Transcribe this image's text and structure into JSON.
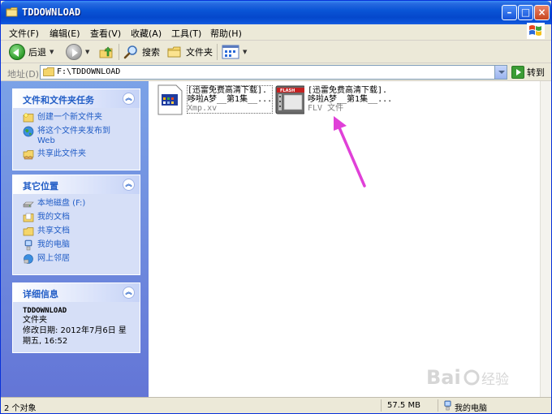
{
  "window": {
    "title": "TDDOWNLOAD"
  },
  "menu": [
    "文件(F)",
    "编辑(E)",
    "查看(V)",
    "收藏(A)",
    "工具(T)",
    "帮助(H)"
  ],
  "toolbar": {
    "back": "后退",
    "search": "搜索",
    "folders": "文件夹"
  },
  "address": {
    "label": "地址(D)",
    "value": "F:\\TDDOWNLOAD",
    "go": "转到"
  },
  "panels": {
    "tasks": {
      "title": "文件和文件夹任务",
      "items": [
        {
          "label": "创建一个新文件夹",
          "icon": "new-folder-icon"
        },
        {
          "label": "将这个文件夹发布到",
          "label2": "Web",
          "icon": "globe-icon"
        },
        {
          "label": "共享此文件夹",
          "icon": "share-folder-icon"
        }
      ]
    },
    "places": {
      "title": "其它位置",
      "items": [
        {
          "label": "本地磁盘 (F:)",
          "icon": "drive-icon"
        },
        {
          "label": "我的文档",
          "icon": "documents-icon"
        },
        {
          "label": "共享文档",
          "icon": "shared-docs-icon"
        },
        {
          "label": "我的电脑",
          "icon": "computer-icon"
        },
        {
          "label": "网上邻居",
          "icon": "network-icon"
        }
      ]
    },
    "details": {
      "title": "详细信息",
      "name": "TDDOWNLOAD",
      "type": "文件夹",
      "modified_line1": "修改日期: 2012年7月6日 星",
      "modified_line2": "期五, 16:52"
    }
  },
  "files": [
    {
      "line1": "[迅雷免费高清下载].",
      "line2": "哆啦A梦__第1集__...",
      "sub": "Xmp.xv",
      "icon": "xmp-file-icon"
    },
    {
      "line1": "[迅雷免费高清下载].",
      "line2": "哆啦A梦__第1集__...",
      "sub": "FLV 文件",
      "icon": "flash-file-icon"
    }
  ],
  "status": {
    "objects": "2 个对象",
    "size": "57.5 MB",
    "location": "我的电脑"
  },
  "colors": {
    "accent": "#0a55d6",
    "panel": "#6375d6",
    "link": "#215dc6",
    "annotation": "#e040d8"
  }
}
